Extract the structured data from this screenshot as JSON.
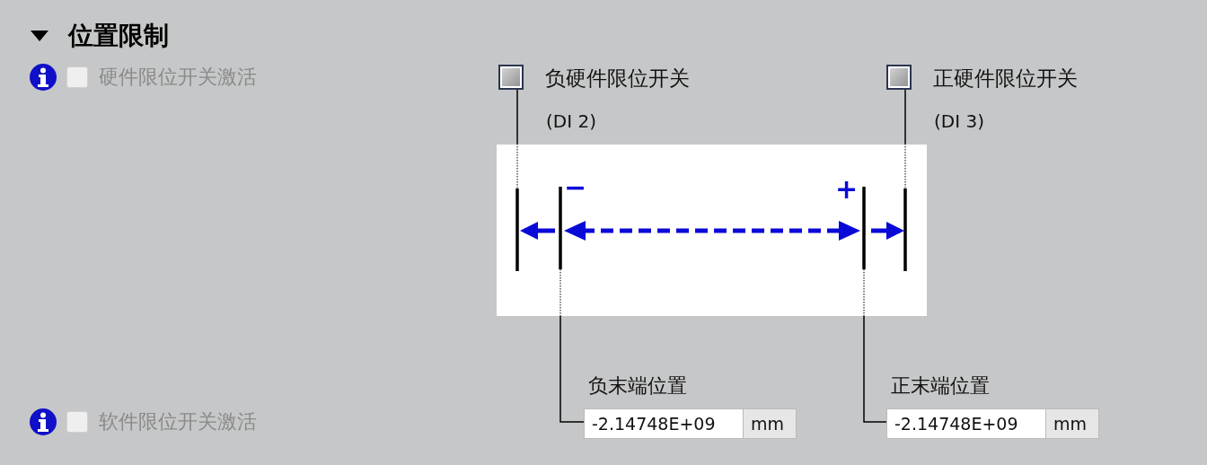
{
  "section": {
    "title": "位置限制",
    "expanded": true
  },
  "hardware_limit": {
    "label": "硬件限位开关激活",
    "checked": false,
    "disabled": true
  },
  "neg_hw_switch": {
    "label": "负硬件限位开关",
    "input": "(DI 2)",
    "checked": false
  },
  "pos_hw_switch": {
    "label": "正硬件限位开关",
    "input": "(DI 3)",
    "checked": false
  },
  "diagram": {
    "minus": "−",
    "plus": "+"
  },
  "neg_end": {
    "label": "负末端位置",
    "value": "-2.14748E+09",
    "unit": "mm"
  },
  "pos_end": {
    "label": "正末端位置",
    "value": "-2.14748E+09",
    "unit": "mm"
  },
  "software_limit": {
    "label": "软件限位开关激活",
    "checked": false,
    "disabled": true
  }
}
